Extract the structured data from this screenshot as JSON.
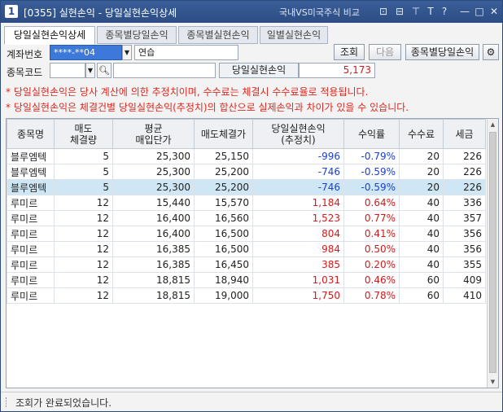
{
  "window": {
    "app_number": "1",
    "title": "[0355] 실현손익 - 당일실현손익상세",
    "compare_label": "국내VS미국주식 비교",
    "buttons": [
      "⊡",
      "⊟",
      "⊤",
      "T",
      "?",
      "—",
      "□",
      "✕"
    ]
  },
  "tabs": [
    "당일실현손익상세",
    "종목별당일손익",
    "종목별실현손익",
    "일별실현손익"
  ],
  "account": {
    "label": "계좌번호",
    "number": "****-**04",
    "name": "연습"
  },
  "stock": {
    "label": "종목코드",
    "code": "",
    "name": ""
  },
  "buttons": {
    "search": "조회",
    "next": "다음",
    "by_stock": "종목별당일손익",
    "settings": "⚙"
  },
  "pnl": {
    "label": "당일실현손익",
    "value": "5,173"
  },
  "notices": [
    "* 당일실현손익은 당사 계산에 의한 추정치이며, 수수료는 체결시 수수료율로 적용됩니다.",
    "* 당일실현손익은 체결건별 당일실현손익(추정치)의 합산으로 실제손익과 차이가 있을 수 있습니다."
  ],
  "table": {
    "headers": [
      [
        "종목명",
        ""
      ],
      [
        "매도",
        "체결량"
      ],
      [
        "평균",
        "매입단가"
      ],
      [
        "매도체결가",
        ""
      ],
      [
        "당일실현손익",
        "(추정치)"
      ],
      [
        "수익률",
        ""
      ],
      [
        "수수료",
        ""
      ],
      [
        "세금",
        ""
      ]
    ],
    "rows": [
      {
        "name": "블루엠텍",
        "qty": "5",
        "avg": "25,300",
        "sell": "25,150",
        "pnl": "-996",
        "rate": "-0.79%",
        "fee": "20",
        "tax": "226",
        "sign": "neg"
      },
      {
        "name": "블루엠텍",
        "qty": "5",
        "avg": "25,300",
        "sell": "25,200",
        "pnl": "-746",
        "rate": "-0.59%",
        "fee": "20",
        "tax": "226",
        "sign": "neg"
      },
      {
        "name": "블루엠텍",
        "qty": "5",
        "avg": "25,300",
        "sell": "25,200",
        "pnl": "-746",
        "rate": "-0.59%",
        "fee": "20",
        "tax": "226",
        "sign": "neg",
        "selected": true
      },
      {
        "name": "루미르",
        "qty": "12",
        "avg": "15,440",
        "sell": "15,570",
        "pnl": "1,184",
        "rate": "0.64%",
        "fee": "40",
        "tax": "336",
        "sign": "pos"
      },
      {
        "name": "루미르",
        "qty": "12",
        "avg": "16,400",
        "sell": "16,560",
        "pnl": "1,523",
        "rate": "0.77%",
        "fee": "40",
        "tax": "357",
        "sign": "pos"
      },
      {
        "name": "루미르",
        "qty": "12",
        "avg": "16,400",
        "sell": "16,500",
        "pnl": "804",
        "rate": "0.41%",
        "fee": "40",
        "tax": "356",
        "sign": "pos"
      },
      {
        "name": "루미르",
        "qty": "12",
        "avg": "16,385",
        "sell": "16,500",
        "pnl": "984",
        "rate": "0.50%",
        "fee": "40",
        "tax": "356",
        "sign": "pos"
      },
      {
        "name": "루미르",
        "qty": "12",
        "avg": "16,385",
        "sell": "16,450",
        "pnl": "385",
        "rate": "0.20%",
        "fee": "40",
        "tax": "355",
        "sign": "pos"
      },
      {
        "name": "루미르",
        "qty": "12",
        "avg": "18,815",
        "sell": "18,940",
        "pnl": "1,031",
        "rate": "0.46%",
        "fee": "60",
        "tax": "409",
        "sign": "pos"
      },
      {
        "name": "루미르",
        "qty": "12",
        "avg": "18,815",
        "sell": "19,000",
        "pnl": "1,750",
        "rate": "0.78%",
        "fee": "60",
        "tax": "410",
        "sign": "pos"
      }
    ]
  },
  "status": "조회가 완료되었습니다."
}
